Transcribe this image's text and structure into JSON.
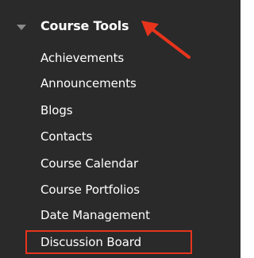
{
  "header": {
    "title": "Course Tools",
    "icon": "triangle-down-icon"
  },
  "menu": {
    "items": [
      {
        "label": "Achievements"
      },
      {
        "label": "Announcements"
      },
      {
        "label": "Blogs"
      },
      {
        "label": "Contacts"
      },
      {
        "label": "Course Calendar"
      },
      {
        "label": "Course Portfolios"
      },
      {
        "label": "Date Management"
      },
      {
        "label": "Discussion Board",
        "highlighted": true
      }
    ]
  },
  "colors": {
    "background": "#2a2a2a",
    "text": "#ffffff",
    "annotation": "#e8341c"
  }
}
